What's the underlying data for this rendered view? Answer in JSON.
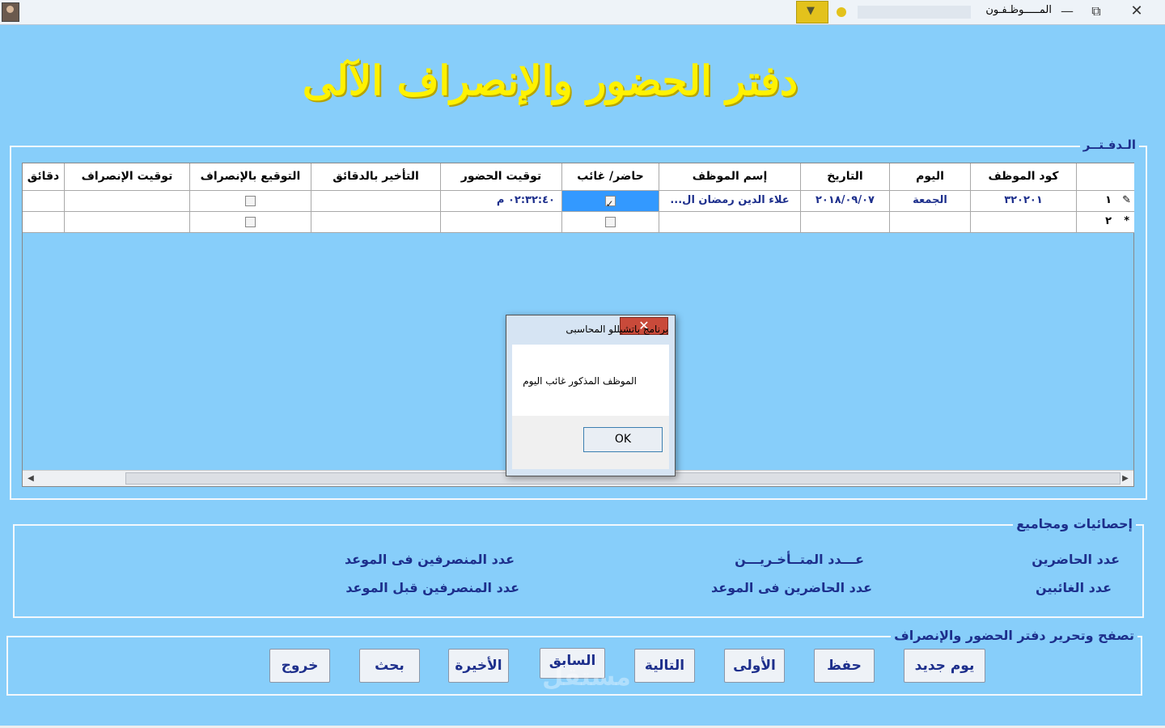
{
  "window": {
    "title": "المـــــوظـفـون",
    "minimize": "—",
    "restore": "⧉",
    "close": "✕",
    "dropdown_glyph": "▼"
  },
  "heading": "دفتر الحضور والإنصراف الآلى",
  "register": {
    "group_label": "الـدفـتــر",
    "columns": [
      "كود الموظف",
      "اليوم",
      "التاريخ",
      "إسم الموظف",
      "حاضر/ غائب",
      "توقيت الحضور",
      "التأخير بالدقائق",
      "التوقيع بالإنصراف",
      "توقيت الإنصراف",
      "دقائق"
    ],
    "rows": [
      {
        "row_number": "١",
        "row_marker": "✎",
        "employee_code": "٣٢٠٢٠١",
        "day": "الجمعة",
        "date": "٢٠١٨/٠٩/٠٧",
        "employee_name": "علاء الدين رمضان ال...",
        "present": true,
        "attendance_time": "٠٢:٣٢:٤٠ م",
        "delay_minutes": "",
        "departure_signed": false,
        "departure_time": "",
        "minutes": ""
      },
      {
        "row_number": "٢",
        "row_marker": "*",
        "employee_code": "",
        "day": "",
        "date": "",
        "employee_name": "",
        "present": false,
        "attendance_time": "",
        "delay_minutes": "",
        "departure_signed": false,
        "departure_time": "",
        "minutes": ""
      }
    ]
  },
  "stats": {
    "group_label": "إحصائيات ومجاميع",
    "present_count": "عدد الحاضرين",
    "late_count": "عـــدد المتــأخـريـــن",
    "departed_on_time": "عدد  المنصرفين فى الموعد",
    "absent_count": "عدد الغائبين",
    "present_on_time": "عدد الحاضرين فى الموعد",
    "departed_early": "عدد المنصرفين قبل الموعد"
  },
  "nav": {
    "group_label": "تصفح وتحرير دفتر الحضور والإنصراف",
    "new_day": "يوم جديد",
    "save": "حفظ",
    "first": "الأولى",
    "next": "التالية",
    "previous": "السابق",
    "last": "الأخيرة",
    "search": "بحث",
    "exit": "خروج"
  },
  "dialog": {
    "title": "برنامج باتشيللو المحاسبى",
    "close": "✕",
    "message": "الموظف المذكور غائب اليوم",
    "ok": "OK"
  },
  "watermark": "مستقل"
}
